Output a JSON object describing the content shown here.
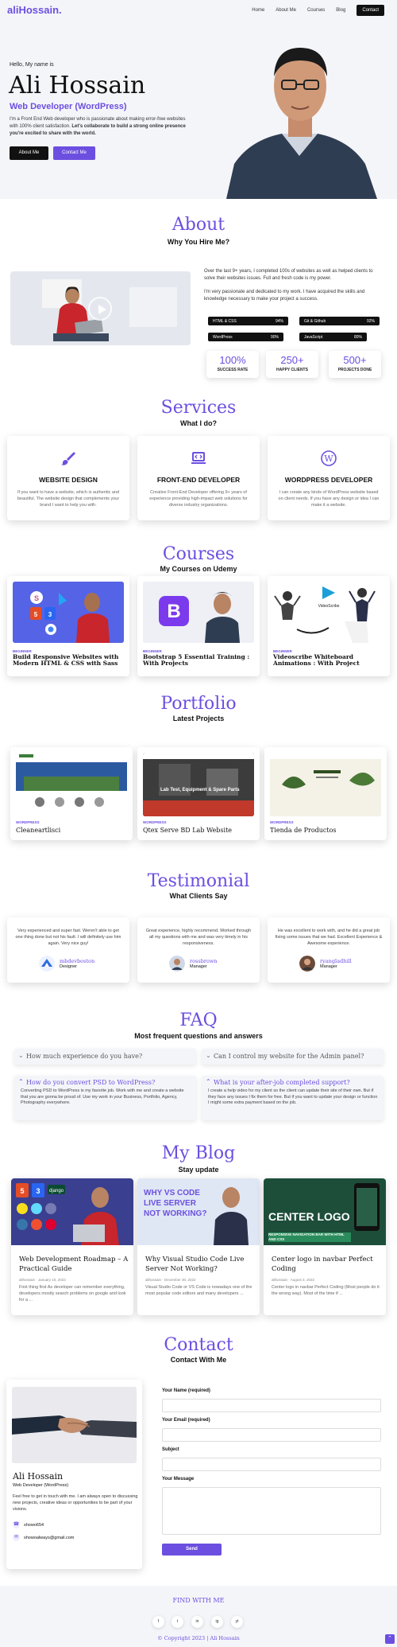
{
  "brand": {
    "logo": "aliHossain.",
    "accent": "#6c4fe0"
  },
  "nav": {
    "items": [
      "Home",
      "About Me",
      "Courses",
      "Blog"
    ],
    "cta": "Contact"
  },
  "hero": {
    "greeting": "Hello, My name is",
    "name": "Ali Hossain",
    "role": "Web Developer (WordPress)",
    "description": "I'm a Front End Web developer who is passionate about making error-free websites with 100% client satisfaction.",
    "description_bold": "Let's collaborate to build a strong online presence you're excited to share with the world.",
    "btn_about": "About Me",
    "btn_contact": "Contact Me"
  },
  "about": {
    "title": "About",
    "subtitle": "Why You Hire Me?",
    "para1": "Over the last 9+ years, I completed 100s of websites as well as helped clients to solve their websites issues. Full and fresh code is my power.",
    "para2": "I'm very passionate and dedicated to my work. I have acquired the skills and knowledge necessary to make your project a success.",
    "skills": [
      {
        "name": "HTML & CSS",
        "value": "94%"
      },
      {
        "name": "Git & Github",
        "value": "92%"
      },
      {
        "name": "WordPress",
        "value": "90%"
      },
      {
        "name": "JavaScript",
        "value": "80%"
      }
    ],
    "stats": [
      {
        "num": "100%",
        "label": "SUCCESS RATE"
      },
      {
        "num": "250+",
        "label": "HAPPY CLIENTS"
      },
      {
        "num": "500+",
        "label": "PROJECTS DONE"
      }
    ]
  },
  "services": {
    "title": "Services",
    "subtitle": "What I do?",
    "items": [
      {
        "icon": "paintbrush-icon",
        "title": "WEBSITE DESIGN",
        "desc": "If you want to have a website, which is authentic and beautiful. The website design that complements your brand I want to help you with."
      },
      {
        "icon": "laptop-code-icon",
        "title": "FRONT-END DEVELOPER",
        "desc": "Creative Front-End Developer offering 9+ years of experience providing high-impact web solutions for diverse industry organizations."
      },
      {
        "icon": "wordpress-icon",
        "title": "WORDPRESS DEVELOPER",
        "desc": "I can create any kinds of WordPress website based on client needs. If you have any design or idea I can make it a website."
      }
    ]
  },
  "courses": {
    "title": "Courses",
    "subtitle": "My Courses on Udemy",
    "items": [
      {
        "level": "BEGINNER",
        "title": "Build Responsive Websites with Modern HTML & CSS with Sass"
      },
      {
        "level": "BEGINNER",
        "title": "Bootstrap 5 Essential Training : With Projects"
      },
      {
        "level": "BEGINNER",
        "title": "Videoscribe Whiteboard Animations : With Project"
      }
    ]
  },
  "portfolio": {
    "title": "Portfolio",
    "subtitle": "Latest Projects",
    "items": [
      {
        "category": "WORDPRESS",
        "title": "Cleaneartlisci"
      },
      {
        "category": "WORDPRESS",
        "title": "Qtex Serve BD Lab Website",
        "img_text": "Lab Test, Equipment & Spare Parts"
      },
      {
        "category": "WORDPRESS",
        "title": "Tienda de Productos"
      }
    ]
  },
  "testimonial": {
    "title": "Testimonial",
    "subtitle": "What Clients Say",
    "items": [
      {
        "quote": "Very experienced and super fast. Weren't able to get one thing done but not his fault. I will definitely use him again. Very nice guy!",
        "name": "mbdevboston",
        "role": "Designer"
      },
      {
        "quote": "Great experience, highly recommend. Worked through all my questions with me and was very timely in his responsiveness.",
        "name": "rossbrown",
        "role": "Manager"
      },
      {
        "quote": "He was excellent to work with, and he did a great job fixing some issues that we had. Excellent Experience & Awesome experience.",
        "name": "ryangladhill",
        "role": "Manager"
      }
    ]
  },
  "faq": {
    "title": "FAQ",
    "subtitle": "Most frequent questions and answers",
    "items": [
      {
        "q": "How much experience do you have?"
      },
      {
        "q": "Can I control my website for the Admin panel?"
      },
      {
        "q": "How do you convert PSD to WordPress?",
        "a": "Converting PSD to WordPress is my favorite job. Work with me and create a website that you are gonna be proud of. Use my work in your Business, Portfolio, Agency, Photography everywhere."
      },
      {
        "q": "What is your after-job completed support?",
        "a": "I create a help video for my client so the client can update their site of their own. But if they face any issues I fix them for free. But if you want to update your design or function I might some extra payment based on the job."
      }
    ]
  },
  "blog": {
    "title": "My Blog",
    "subtitle": "Stay update",
    "items": [
      {
        "title": "Web Development Roadmap – A Practical Guide",
        "meta": "alihossain · January 10, 2023",
        "excerpt": "First thing first As developer can remember everything, developers mostly search problems on google and look for a ..."
      },
      {
        "title": "Why Visual Studio Code Live Server Not Working?",
        "meta": "alihossain · December 30, 2022",
        "excerpt": "Visual Studio Code or VS Code is nowadays one of the most popular code editors and many developers ...",
        "img_text": "WHY VS CODE LIVE SERVER NOT WORKING?"
      },
      {
        "title": "Center logo in navbar Perfect Coding",
        "meta": "alihossain · August 3, 2022",
        "excerpt": "Center logo in navbar Perfect Coding (Most people do it the wrong way). Most of the time if ...",
        "img_text1": "CENTER LOGO",
        "img_text2": "RESPONSIVE NAVIGATION BAR WITH HTML AND CSS"
      }
    ]
  },
  "contact": {
    "title": "Contact",
    "subtitle": "Contact With Me",
    "name": "Ali Hossain",
    "role": "Web Developer (WordPress)",
    "desc": "Feel free to get in touch with me. I am always open to discussing new projects, creative ideas or opportunities to be part of your visions.",
    "phone": "showo654",
    "email": "showoalways@gmail.com",
    "form": {
      "name_label": "Your Name (required)",
      "email_label": "Your Email (required)",
      "subject_label": "Subject",
      "message_label": "Your Message",
      "send": "Send"
    }
  },
  "footer": {
    "find": "FIND WITH ME",
    "socials": [
      "f",
      "t",
      "in",
      "ig",
      "yt"
    ],
    "copyright": "© Copyright 2023 | Ali Hossain"
  }
}
